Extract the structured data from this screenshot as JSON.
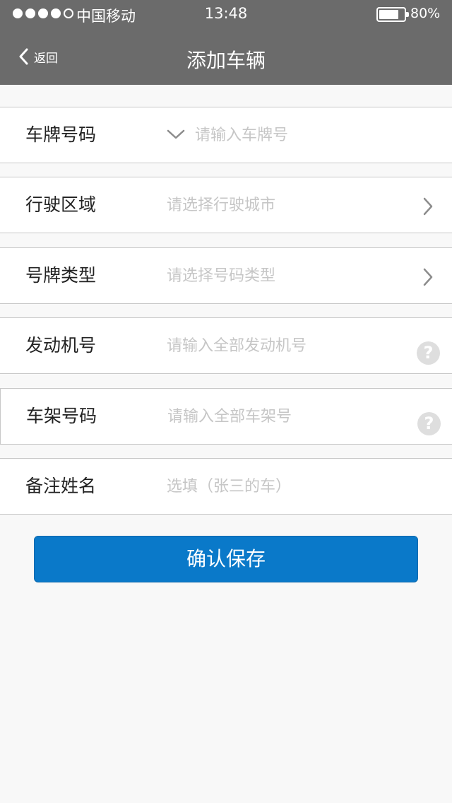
{
  "status_bar": {
    "signal_dots": 5,
    "signal_filled": 4,
    "carrier": "中国移动",
    "time": "13:48",
    "battery_percent": "80%",
    "battery_level": 0.8
  },
  "nav": {
    "back_label": "返回",
    "title": "添加车辆"
  },
  "form": {
    "plate": {
      "label": "车牌号码",
      "placeholder": "请输入车牌号",
      "value": ""
    },
    "region": {
      "label": "行驶区域",
      "placeholder": "请选择行驶城市",
      "value": ""
    },
    "plate_type": {
      "label": "号牌类型",
      "placeholder": "请选择号码类型",
      "value": ""
    },
    "engine": {
      "label": "发动机号",
      "placeholder": "请输入全部发动机号",
      "value": "",
      "help": "?"
    },
    "vin": {
      "label": "车架号码",
      "placeholder": "请输入全部车架号",
      "value": "",
      "help": "?"
    },
    "note": {
      "label": "备注姓名",
      "placeholder": "选填（张三的车）",
      "value": ""
    }
  },
  "actions": {
    "save_label": "确认保存"
  },
  "colors": {
    "header_bg": "#6b6b6b",
    "page_bg": "#f8f8f8",
    "primary_button": "#0a79c9",
    "placeholder": "#c6c6c6",
    "help_icon_bg": "#dedede"
  },
  "icons": {
    "back": "chevron-left-icon",
    "plate_prefix": "chevron-down-icon",
    "region_arrow": "chevron-right-icon",
    "plate_type_arrow": "chevron-right-icon",
    "engine_help": "question-mark-icon",
    "vin_help": "question-mark-icon"
  }
}
